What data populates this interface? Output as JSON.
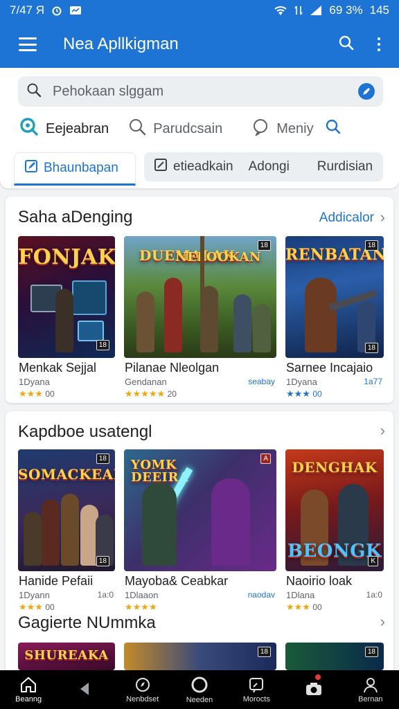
{
  "status_bar": {
    "time": "7/47 Я",
    "battery": "69 3%",
    "extra": "145"
  },
  "app_bar": {
    "title": "Nea Apllkigman"
  },
  "search": {
    "placeholder": "Pehokaan slggam"
  },
  "chips": [
    {
      "label": "Eejeabran"
    },
    {
      "label": "Parudcsain"
    },
    {
      "label": "Meniy"
    }
  ],
  "tabs": {
    "active": "Bhaunbapan",
    "items": [
      "etieadkain",
      "Adongi",
      "Rurdisian"
    ]
  },
  "sections": [
    {
      "title": "Saha aDenging",
      "more": "Addicalor",
      "cards": [
        {
          "poster_title": "FONJAK",
          "name": "Menkak Sejjal",
          "sub": "1Dyana",
          "meta": "",
          "stars": "★★★",
          "rating": "00"
        },
        {
          "poster_title": "DUEMALAK",
          "poster_title2": "NELOOKAN",
          "name": "Pilanae Nleolgan",
          "sub": "Gendanan",
          "meta": "seabay",
          "stars": "★★★★★",
          "rating": "20"
        },
        {
          "poster_title": "RENBATAN",
          "name": "Sarnee Incajaio",
          "sub": "1Dyana",
          "meta": "1a77",
          "stars": "★★★",
          "rating": "00"
        }
      ]
    },
    {
      "title": "Kapdboe usatengl",
      "cards": [
        {
          "poster_title": "SOMACKEAN",
          "name": "Hanide Pefaii",
          "sub": "1Dyann",
          "meta": "1a:0",
          "stars": "★★★",
          "rating": "00"
        },
        {
          "poster_title": "YOMK DEEIRA",
          "name": "Mayoba& Ceabkar",
          "sub": "1Dlaaon",
          "meta": "naodav",
          "stars": "★★★★",
          "rating": ""
        },
        {
          "poster_title": "DENGHAK",
          "poster_title2": "BEONGK",
          "name": "Naoirio loak",
          "sub": "1Dlana",
          "meta": "1a:0",
          "stars": "★★★",
          "rating": "00"
        }
      ]
    },
    {
      "title": "Gagierte NUmmka",
      "cards": [
        {
          "poster_title": "SHUREAKA"
        },
        {
          "poster_title": ""
        },
        {
          "poster_title": ""
        }
      ]
    }
  ],
  "bottom_nav": [
    {
      "label": "Beanng",
      "icon": "home-icon"
    },
    {
      "label": "",
      "icon": "back-icon"
    },
    {
      "label": "Nenbdset",
      "icon": "compass-icon"
    },
    {
      "label": "Needen",
      "icon": "circle-home-icon"
    },
    {
      "label": "Morocts",
      "icon": "search-pin-icon"
    },
    {
      "label": "",
      "icon": "camera-icon"
    },
    {
      "label": "Bernan",
      "icon": "person-icon"
    }
  ],
  "colors": {
    "primary": "#1e74d4",
    "star": "#f2a60c"
  }
}
